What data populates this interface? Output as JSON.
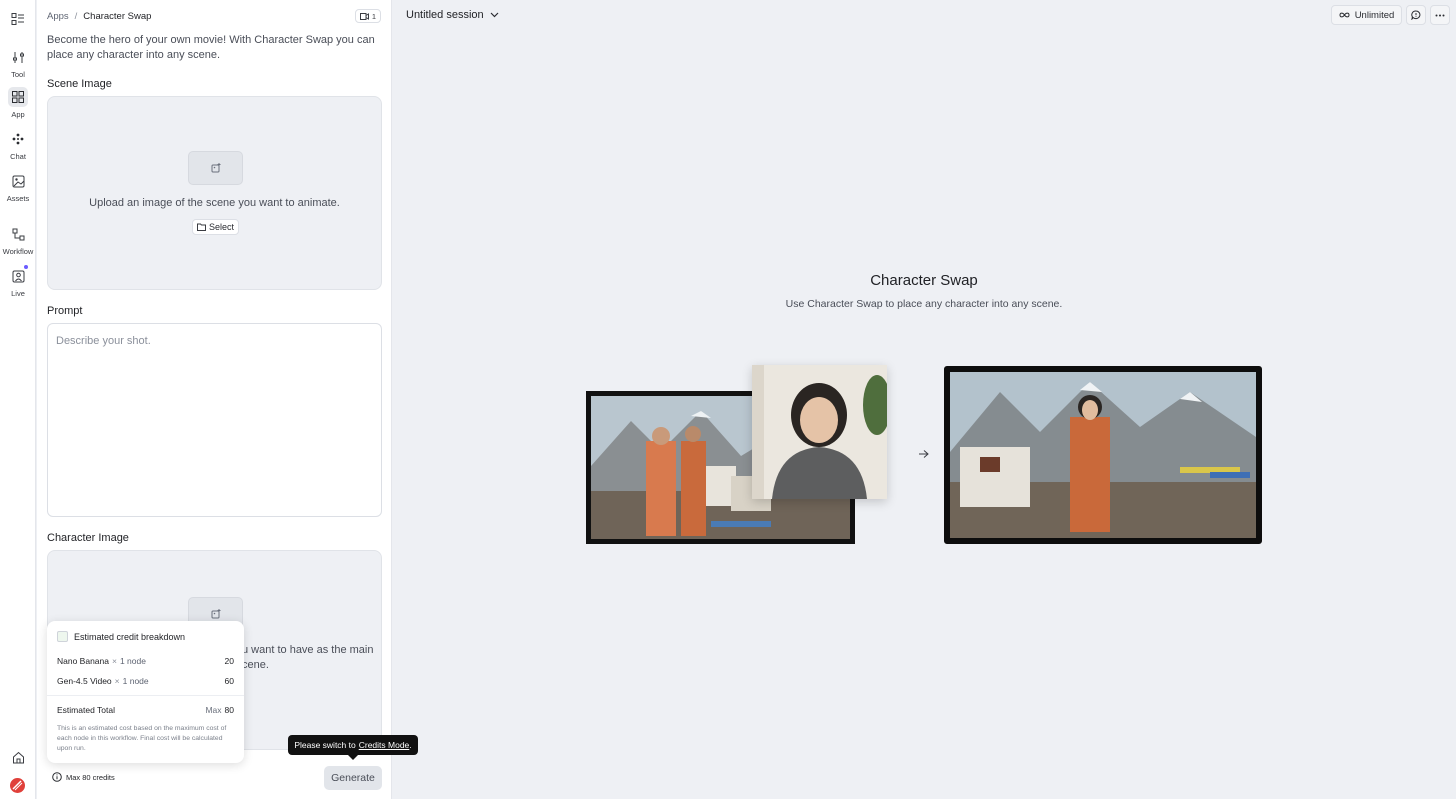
{
  "rail": {
    "items": [
      {
        "label": "Tool"
      },
      {
        "label": "App"
      },
      {
        "label": "Chat"
      },
      {
        "label": "Assets"
      },
      {
        "label": "Workflow"
      },
      {
        "label": "Live"
      }
    ]
  },
  "panel": {
    "breadcrumb": {
      "root": "Apps",
      "separator": "/",
      "current": "Character Swap"
    },
    "video_count": "1",
    "description": "Become the hero of your own movie! With Character Swap you can place any character into any scene.",
    "scene": {
      "label": "Scene Image",
      "hint": "Upload an image of the scene you want to animate.",
      "select_label": "Select"
    },
    "prompt": {
      "label": "Prompt",
      "placeholder": "Describe your shot."
    },
    "character": {
      "label": "Character Image",
      "hint_visible": "u want to have as the main",
      "hint_visible_2": "cene."
    }
  },
  "credits_popover": {
    "title": "Estimated credit breakdown",
    "rows": [
      {
        "model": "Nano Banana",
        "times": "×",
        "nodes": "1 node",
        "credits": "20"
      },
      {
        "model": "Gen-4.5 Video",
        "times": "×",
        "nodes": "1 node",
        "credits": "60"
      }
    ],
    "total_label": "Estimated Total",
    "total_prefix": "Max",
    "total_value": "80",
    "note": "This is an estimated cost based on the maximum cost of each node in this workflow. Final cost will be calculated upon run."
  },
  "footer": {
    "credits": "Max 80 credits",
    "generate": "Generate",
    "tooltip_prefix": "Please switch to",
    "tooltip_link": "Credits Mode",
    "tooltip_suffix": "."
  },
  "header": {
    "session_title": "Untitled session",
    "unlimited_label": "Unlimited"
  },
  "main": {
    "title": "Character Swap",
    "subtitle": "Use Character Swap to place any character into any scene."
  },
  "colors": {
    "accent": "#6b5cff",
    "logo": "#e0403a",
    "background": "#eef0f4"
  }
}
